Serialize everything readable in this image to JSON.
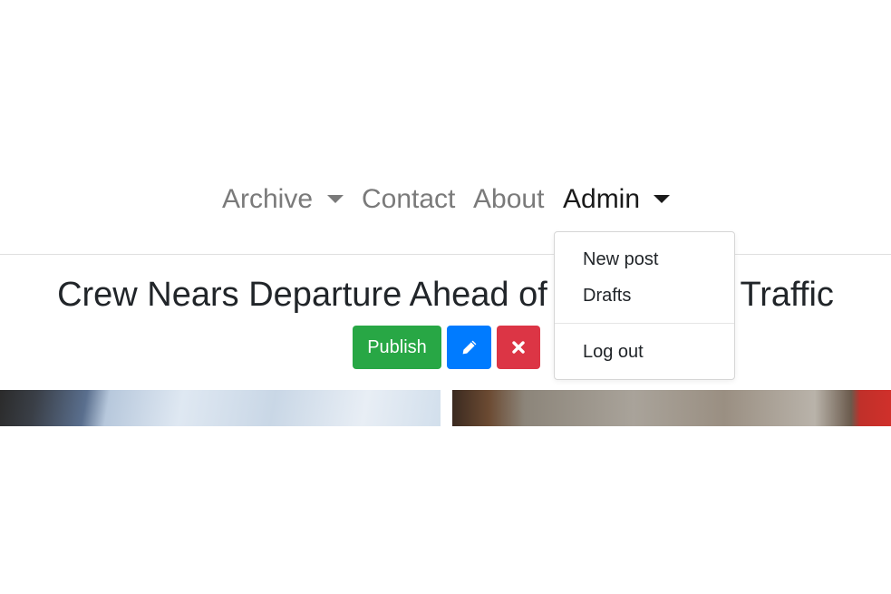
{
  "nav": {
    "archive_label": "Archive",
    "contact_label": "Contact",
    "about_label": "About",
    "admin_label": "Admin"
  },
  "article": {
    "title": "Crew Nears Departure Ahead of Heavy Late Traffic"
  },
  "actions": {
    "publish_label": "Publish",
    "edit_icon": "pencil-icon",
    "delete_icon": "x-icon"
  },
  "admin_menu": {
    "items": [
      {
        "label": "New post"
      },
      {
        "label": "Drafts"
      },
      {
        "label": "Log out"
      }
    ]
  },
  "colors": {
    "publish": "#28a745",
    "edit": "#007bff",
    "delete": "#dc3545",
    "nav_inactive": "#7a7a7a",
    "nav_active": "#1a1a1a"
  }
}
